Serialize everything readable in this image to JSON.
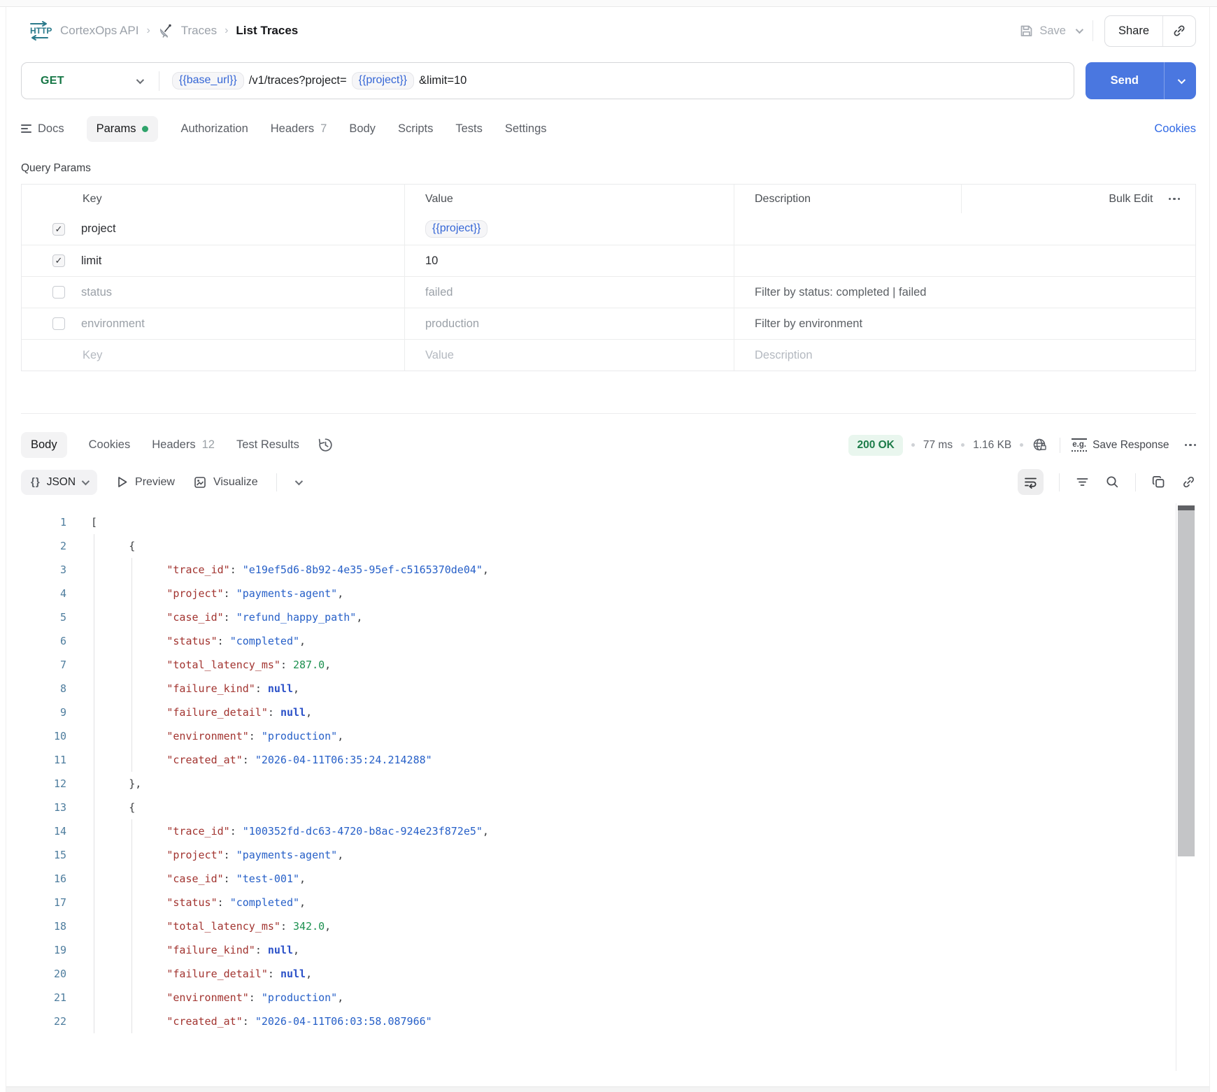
{
  "colors": {
    "accent_blue": "#4a77e0",
    "method_green": "#157645",
    "status_green": "#1d7c49",
    "status_green_bg": "#e9f6ee",
    "var_blue": "#3566d6",
    "http_teal": "#2b7a8b"
  },
  "topbar": {
    "breadcrumb": {
      "app": "CortexOps API",
      "separator": "›",
      "folder": "Traces",
      "current": "List Traces"
    },
    "save_label": "Save",
    "share_label": "Share"
  },
  "request": {
    "method": "GET",
    "send_label": "Send",
    "url_parts": [
      {
        "type": "var",
        "text": "{{base_url}}"
      },
      {
        "type": "text",
        "text": "/v1/traces?project="
      },
      {
        "type": "var",
        "text": "{{project}}"
      },
      {
        "type": "text",
        "text": "&limit=10"
      }
    ]
  },
  "request_tabs": {
    "items": [
      {
        "label": "Docs",
        "icon": "docs"
      },
      {
        "label": "Params",
        "active": true,
        "dot": true
      },
      {
        "label": "Authorization"
      },
      {
        "label": "Headers",
        "count": "7"
      },
      {
        "label": "Body"
      },
      {
        "label": "Scripts"
      },
      {
        "label": "Tests"
      },
      {
        "label": "Settings"
      }
    ],
    "cookies_link": "Cookies"
  },
  "query_params": {
    "title": "Query Params",
    "headers": {
      "key": "Key",
      "value": "Value",
      "description": "Description"
    },
    "bulk_edit": "Bulk Edit",
    "rows": [
      {
        "key": "project",
        "value": "{{project}}",
        "value_is_var": true,
        "description": "",
        "checked": true,
        "enabled": true
      },
      {
        "key": "limit",
        "value": "10",
        "value_is_var": false,
        "description": "",
        "checked": true,
        "enabled": true
      },
      {
        "key": "status",
        "value": "failed",
        "value_is_var": false,
        "description": "Filter by status: completed | failed",
        "checked": false,
        "enabled": false
      },
      {
        "key": "environment",
        "value": "production",
        "value_is_var": false,
        "description": "Filter by environment",
        "checked": false,
        "enabled": false
      }
    ],
    "placeholder_row": {
      "key": "Key",
      "value": "Value",
      "description": "Description"
    }
  },
  "response": {
    "tabs": [
      {
        "label": "Body",
        "active": true
      },
      {
        "label": "Cookies"
      },
      {
        "label": "Headers",
        "count": "12"
      },
      {
        "label": "Test Results"
      }
    ],
    "status": "200 OK",
    "time": "77 ms",
    "size": "1.16 KB",
    "eg_label": "e.g.",
    "save_response_label": "Save Response"
  },
  "viewer": {
    "braces": "{}",
    "format": "JSON",
    "preview_label": "Preview",
    "visualize_label": "Visualize"
  },
  "code": {
    "lines": [
      {
        "n": 1,
        "indent": 0,
        "guides": [],
        "tokens": [
          [
            "punc",
            "["
          ]
        ]
      },
      {
        "n": 2,
        "indent": 6,
        "guides": [
          0
        ],
        "tokens": [
          [
            "punc",
            "{"
          ]
        ]
      },
      {
        "n": 3,
        "indent": 12,
        "guides": [
          0,
          1
        ],
        "tokens": [
          [
            "key",
            "\"trace_id\""
          ],
          [
            "punc",
            ": "
          ],
          [
            "str",
            "\"e19ef5d6-8b92-4e35-95ef-c5165370de04\""
          ],
          [
            "punc",
            ","
          ]
        ]
      },
      {
        "n": 4,
        "indent": 12,
        "guides": [
          0,
          1
        ],
        "tokens": [
          [
            "key",
            "\"project\""
          ],
          [
            "punc",
            ": "
          ],
          [
            "str",
            "\"payments-agent\""
          ],
          [
            "punc",
            ","
          ]
        ]
      },
      {
        "n": 5,
        "indent": 12,
        "guides": [
          0,
          1
        ],
        "tokens": [
          [
            "key",
            "\"case_id\""
          ],
          [
            "punc",
            ": "
          ],
          [
            "str",
            "\"refund_happy_path\""
          ],
          [
            "punc",
            ","
          ]
        ]
      },
      {
        "n": 6,
        "indent": 12,
        "guides": [
          0,
          1
        ],
        "tokens": [
          [
            "key",
            "\"status\""
          ],
          [
            "punc",
            ": "
          ],
          [
            "str",
            "\"completed\""
          ],
          [
            "punc",
            ","
          ]
        ]
      },
      {
        "n": 7,
        "indent": 12,
        "guides": [
          0,
          1
        ],
        "tokens": [
          [
            "key",
            "\"total_latency_ms\""
          ],
          [
            "punc",
            ": "
          ],
          [
            "num",
            "287.0"
          ],
          [
            "punc",
            ","
          ]
        ]
      },
      {
        "n": 8,
        "indent": 12,
        "guides": [
          0,
          1
        ],
        "tokens": [
          [
            "key",
            "\"failure_kind\""
          ],
          [
            "punc",
            ": "
          ],
          [
            "null",
            "null"
          ],
          [
            "punc",
            ","
          ]
        ]
      },
      {
        "n": 9,
        "indent": 12,
        "guides": [
          0,
          1
        ],
        "tokens": [
          [
            "key",
            "\"failure_detail\""
          ],
          [
            "punc",
            ": "
          ],
          [
            "null",
            "null"
          ],
          [
            "punc",
            ","
          ]
        ]
      },
      {
        "n": 10,
        "indent": 12,
        "guides": [
          0,
          1
        ],
        "tokens": [
          [
            "key",
            "\"environment\""
          ],
          [
            "punc",
            ": "
          ],
          [
            "str",
            "\"production\""
          ],
          [
            "punc",
            ","
          ]
        ]
      },
      {
        "n": 11,
        "indent": 12,
        "guides": [
          0,
          1
        ],
        "tokens": [
          [
            "key",
            "\"created_at\""
          ],
          [
            "punc",
            ": "
          ],
          [
            "str",
            "\"2026-04-11T06:35:24.214288\""
          ]
        ]
      },
      {
        "n": 12,
        "indent": 6,
        "guides": [
          0
        ],
        "tokens": [
          [
            "punc",
            "},"
          ]
        ]
      },
      {
        "n": 13,
        "indent": 6,
        "guides": [
          0
        ],
        "tokens": [
          [
            "punc",
            "{"
          ]
        ]
      },
      {
        "n": 14,
        "indent": 12,
        "guides": [
          0,
          1
        ],
        "tokens": [
          [
            "key",
            "\"trace_id\""
          ],
          [
            "punc",
            ": "
          ],
          [
            "str",
            "\"100352fd-dc63-4720-b8ac-924e23f872e5\""
          ],
          [
            "punc",
            ","
          ]
        ]
      },
      {
        "n": 15,
        "indent": 12,
        "guides": [
          0,
          1
        ],
        "tokens": [
          [
            "key",
            "\"project\""
          ],
          [
            "punc",
            ": "
          ],
          [
            "str",
            "\"payments-agent\""
          ],
          [
            "punc",
            ","
          ]
        ]
      },
      {
        "n": 16,
        "indent": 12,
        "guides": [
          0,
          1
        ],
        "tokens": [
          [
            "key",
            "\"case_id\""
          ],
          [
            "punc",
            ": "
          ],
          [
            "str",
            "\"test-001\""
          ],
          [
            "punc",
            ","
          ]
        ]
      },
      {
        "n": 17,
        "indent": 12,
        "guides": [
          0,
          1
        ],
        "tokens": [
          [
            "key",
            "\"status\""
          ],
          [
            "punc",
            ": "
          ],
          [
            "str",
            "\"completed\""
          ],
          [
            "punc",
            ","
          ]
        ]
      },
      {
        "n": 18,
        "indent": 12,
        "guides": [
          0,
          1
        ],
        "tokens": [
          [
            "key",
            "\"total_latency_ms\""
          ],
          [
            "punc",
            ": "
          ],
          [
            "num",
            "342.0"
          ],
          [
            "punc",
            ","
          ]
        ]
      },
      {
        "n": 19,
        "indent": 12,
        "guides": [
          0,
          1
        ],
        "tokens": [
          [
            "key",
            "\"failure_kind\""
          ],
          [
            "punc",
            ": "
          ],
          [
            "null",
            "null"
          ],
          [
            "punc",
            ","
          ]
        ]
      },
      {
        "n": 20,
        "indent": 12,
        "guides": [
          0,
          1
        ],
        "tokens": [
          [
            "key",
            "\"failure_detail\""
          ],
          [
            "punc",
            ": "
          ],
          [
            "null",
            "null"
          ],
          [
            "punc",
            ","
          ]
        ]
      },
      {
        "n": 21,
        "indent": 12,
        "guides": [
          0,
          1
        ],
        "tokens": [
          [
            "key",
            "\"environment\""
          ],
          [
            "punc",
            ": "
          ],
          [
            "str",
            "\"production\""
          ],
          [
            "punc",
            ","
          ]
        ]
      },
      {
        "n": 22,
        "indent": 12,
        "guides": [
          0,
          1
        ],
        "tokens": [
          [
            "key",
            "\"created_at\""
          ],
          [
            "punc",
            ": "
          ],
          [
            "str",
            "\"2026-04-11T06:03:58.087966\""
          ]
        ]
      }
    ]
  }
}
